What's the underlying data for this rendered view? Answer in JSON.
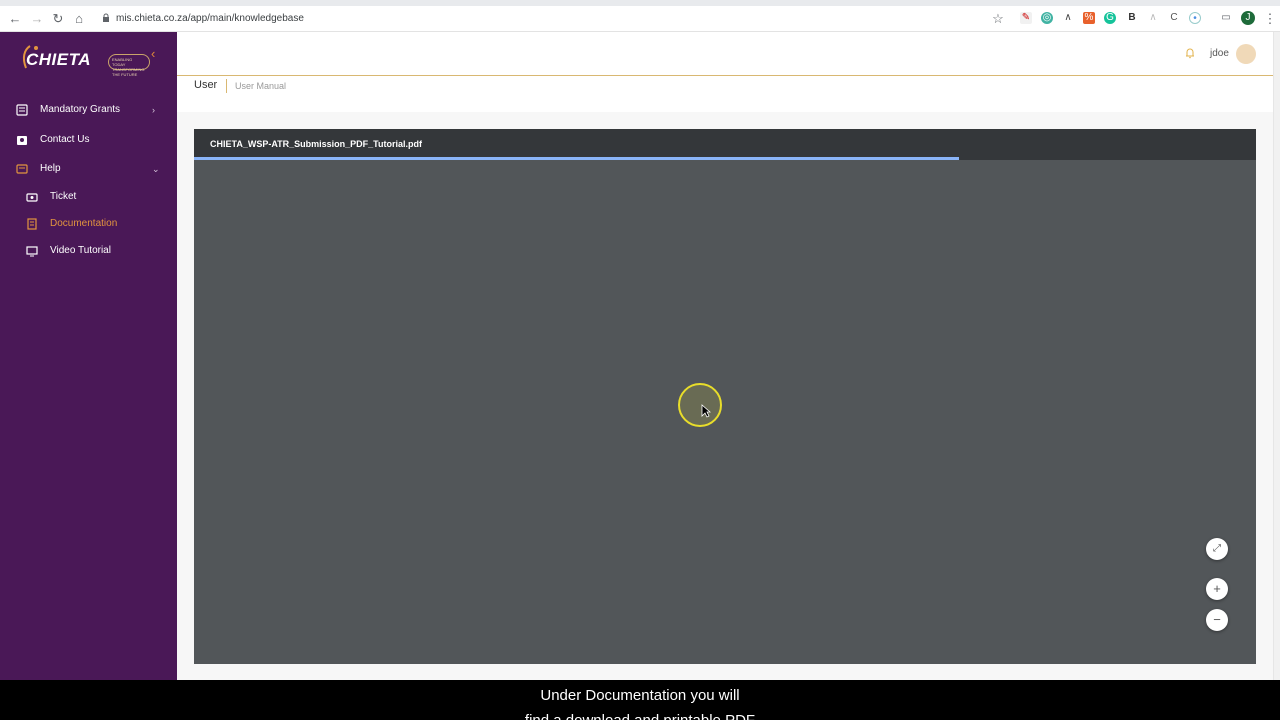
{
  "browser": {
    "url": "mis.chieta.co.za/app/main/knowledgebase",
    "profile_initial": "J"
  },
  "sidebar": {
    "logo_text": "CHIETA",
    "logo_tagline": "ENABLING TODAY TRANSFORMING THE FUTURE",
    "items": [
      {
        "label": "Mandatory Grants",
        "icon": "grants-icon"
      },
      {
        "label": "Contact Us",
        "icon": "contact-icon"
      },
      {
        "label": "Help",
        "icon": "help-icon"
      }
    ],
    "help_children": [
      {
        "label": "Ticket",
        "icon": "ticket-icon"
      },
      {
        "label": "Documentation",
        "icon": "document-icon",
        "active": true
      },
      {
        "label": "Video Tutorial",
        "icon": "monitor-icon"
      }
    ]
  },
  "header": {
    "username": "jdoe"
  },
  "breadcrumb": {
    "section": "User",
    "page": "User Manual"
  },
  "pdf_viewer": {
    "file_name": "CHIETA_WSP-ATR_Submission_PDF_Tutorial.pdf",
    "load_progress_percent": 72
  },
  "caption": {
    "line1": "Under Documentation you will",
    "line2": "find a download and printable PDF"
  },
  "colors": {
    "sidebar_bg": "#4a1857",
    "accent": "#e2953f",
    "pdf_bg": "#525659",
    "pdf_toolbar": "#34373a"
  }
}
